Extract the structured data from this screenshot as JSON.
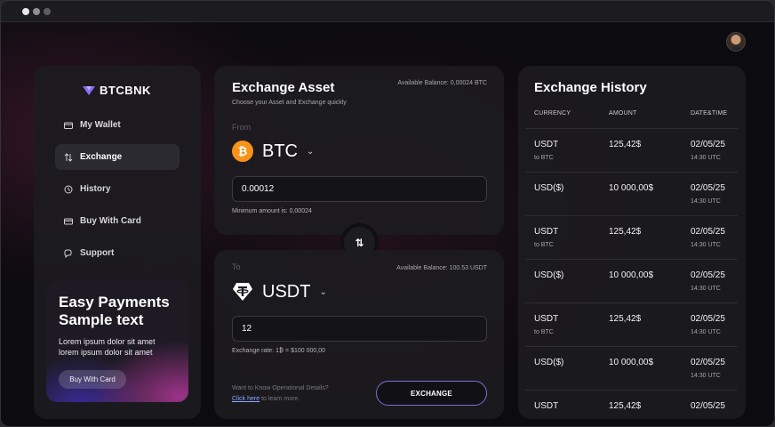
{
  "window": {
    "dots": [
      "close",
      "minimize",
      "zoom"
    ]
  },
  "brand": {
    "name": "BTCBNK",
    "accent": "#8b6cff"
  },
  "sidebar": {
    "items": [
      {
        "label": "My Wallet",
        "icon": "wallet-icon"
      },
      {
        "label": "Exchange",
        "icon": "swap-icon",
        "active": true
      },
      {
        "label": "History",
        "icon": "history-icon"
      },
      {
        "label": "Buy With Card",
        "icon": "card-icon"
      },
      {
        "label": "Support",
        "icon": "support-icon"
      }
    ],
    "promo": {
      "title_line1": "Easy Payments",
      "title_line2": "Sample text",
      "text": "Lorem ipsum dolor sit amet lorem ipsum dolor sit amet",
      "button": "Buy With Card"
    }
  },
  "exchange": {
    "title": "Exchange Asset",
    "subtitle": "Choose your Asset and Exchange quickly",
    "from": {
      "label": "From",
      "balance": "Available Balance: 0,00024 BTC",
      "coin": "BTC",
      "amount": "0.00012",
      "hint": "Minimum amount is: 0,00024"
    },
    "to": {
      "label": "To",
      "balance": "Available Balance: 100.53 USDT",
      "coin": "USDT",
      "amount": "12",
      "hint": "Exchange rate: 1₿ = $100 000,00"
    },
    "details_prefix": "Want to Know Operational Details?",
    "details_link": "Click here",
    "details_suffix": " to learn more.",
    "button": "EXCHANGE"
  },
  "history": {
    "title": "Exchange History",
    "columns": [
      "CURRENCY",
      "AMOUNT",
      "DATE&TIME"
    ],
    "rows": [
      {
        "currency": "USDT",
        "sub": "to BTC",
        "amount": "125,42$",
        "date": "02/05/25",
        "time": "14:30 UTC"
      },
      {
        "currency": "USD($)",
        "sub": "",
        "amount": "10 000,00$",
        "date": "02/05/25",
        "time": "14:30 UTC"
      },
      {
        "currency": "USDT",
        "sub": "to BTC",
        "amount": "125,42$",
        "date": "02/05/25",
        "time": "14:30 UTC"
      },
      {
        "currency": "USD($)",
        "sub": "",
        "amount": "10 000,00$",
        "date": "02/05/25",
        "time": "14:30 UTC"
      },
      {
        "currency": "USDT",
        "sub": "to BTC",
        "amount": "125,42$",
        "date": "02/05/25",
        "time": "14:30 UTC"
      },
      {
        "currency": "USD($)",
        "sub": "",
        "amount": "10 000,00$",
        "date": "02/05/25",
        "time": "14:30 UTC"
      },
      {
        "currency": "USDT",
        "sub": "",
        "amount": "125,42$",
        "date": "02/05/25",
        "time": ""
      }
    ]
  },
  "colors": {
    "btc": "#f7931a",
    "usdt": "#ffffff",
    "background": "#0c0b0f",
    "panel": "#1c1b1f"
  }
}
